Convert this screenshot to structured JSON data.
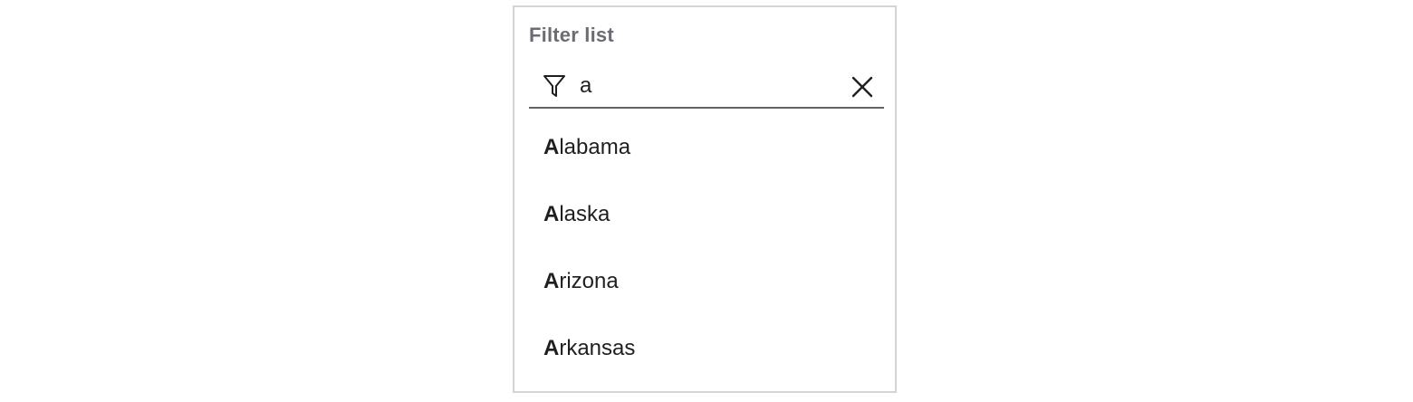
{
  "filter": {
    "label": "Filter list",
    "value": "a",
    "icon": "filter-icon",
    "clear_icon": "close-icon"
  },
  "results": [
    {
      "match": "A",
      "rest": "labama"
    },
    {
      "match": "A",
      "rest": "laska"
    },
    {
      "match": "A",
      "rest": "rizona"
    },
    {
      "match": "A",
      "rest": "rkansas"
    }
  ],
  "colors": {
    "border": "#d4d4d6",
    "underline": "#626268",
    "label": "#6c6c72",
    "text": "#1f1f1f"
  }
}
